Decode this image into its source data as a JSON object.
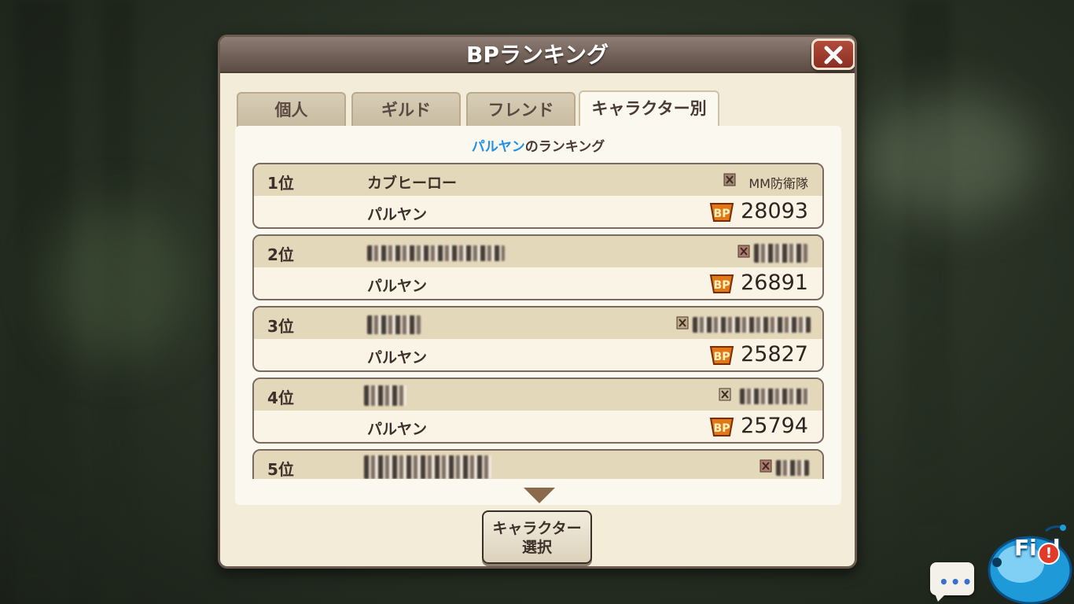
{
  "dialog": {
    "title": "BPランキング",
    "close_icon": "close-icon"
  },
  "tabs": [
    {
      "label": "個人",
      "active": false
    },
    {
      "label": "ギルド",
      "active": false
    },
    {
      "label": "フレンド",
      "active": false
    },
    {
      "label": "キャラクター別",
      "active": true
    }
  ],
  "ranking": {
    "character": "パルヤン",
    "title_suffix": "のランキング",
    "rows": [
      {
        "rank": "1位",
        "player": "カブヒーロー",
        "guild": "MM防衛隊",
        "character": "パルヤン",
        "bp": "28093"
      },
      {
        "rank": "2位",
        "player": "",
        "guild": "",
        "character": "パルヤン",
        "bp": "26891"
      },
      {
        "rank": "3位",
        "player": "",
        "guild": "",
        "character": "パルヤン",
        "bp": "25827"
      },
      {
        "rank": "4位",
        "player": "",
        "guild": "",
        "character": "パルヤン",
        "bp": "25794"
      },
      {
        "rank": "5位",
        "player": "",
        "guild": "",
        "character": "",
        "bp": ""
      }
    ]
  },
  "select_button": {
    "line1": "キャラクター",
    "line2": "選択"
  },
  "corner": {
    "chat_icon": "speech-bubble-icon",
    "field_label": "Fi d",
    "alert_mark": "!"
  },
  "colors": {
    "title_bar": "#6f5e55",
    "panel_bg": "#f3ecd9",
    "highlight": "#1e90e8",
    "close_button": "#8b2e22"
  }
}
